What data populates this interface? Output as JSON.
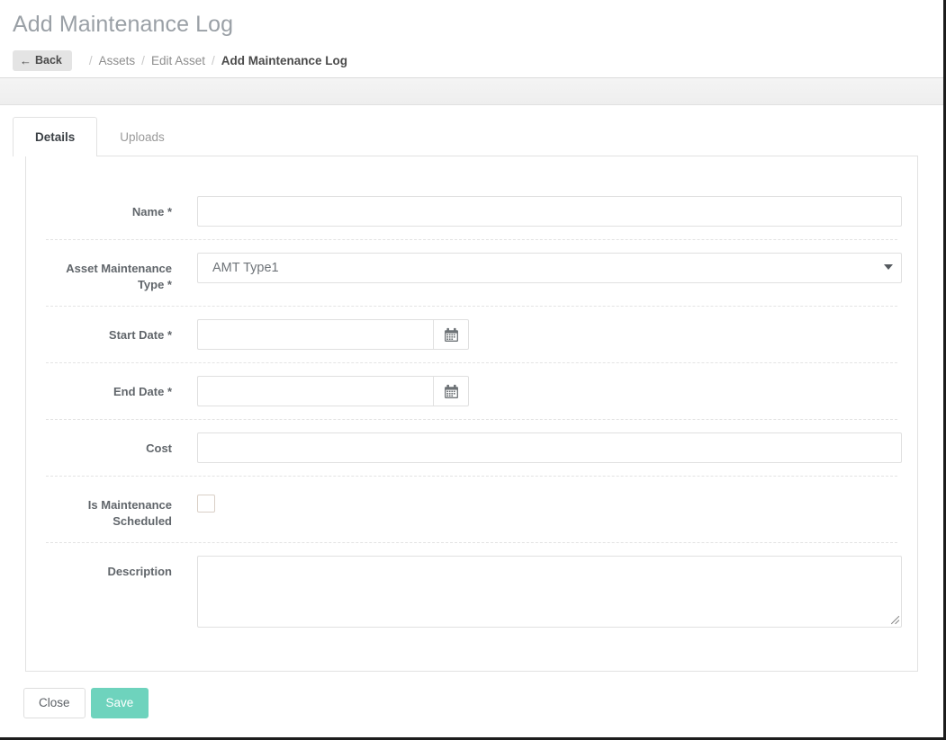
{
  "header": {
    "title": "Add Maintenance Log",
    "back_label": "Back",
    "back_icon": "arrow-left-icon",
    "breadcrumb": {
      "separator": "/",
      "items": [
        {
          "label": "Assets",
          "current": false
        },
        {
          "label": "Edit Asset",
          "current": false
        },
        {
          "label": "Add Maintenance Log",
          "current": true
        }
      ]
    }
  },
  "tabs": [
    {
      "label": "Details",
      "active": true
    },
    {
      "label": "Uploads",
      "active": false
    }
  ],
  "form": {
    "name": {
      "label": "Name *",
      "value": "",
      "placeholder": ""
    },
    "asset_maintenance_type": {
      "label": "Asset Maintenance Type *",
      "selected": "AMT Type1",
      "caret_icon": "chevron-down-icon"
    },
    "start_date": {
      "label": "Start Date *",
      "value": "",
      "placeholder": "",
      "picker_icon": "calendar-icon"
    },
    "end_date": {
      "label": "End Date *",
      "value": "",
      "placeholder": "",
      "picker_icon": "calendar-icon"
    },
    "cost": {
      "label": "Cost",
      "value": "",
      "placeholder": ""
    },
    "is_maintenance_scheduled": {
      "label": "Is Maintenance Scheduled",
      "checked": false
    },
    "description": {
      "label": "Description",
      "value": "",
      "placeholder": ""
    }
  },
  "footer": {
    "close_label": "Close",
    "save_label": "Save"
  },
  "colors": {
    "save_button": "#6ed3bd",
    "title_text": "#9aa0a6",
    "label_text": "#61666b",
    "toolbar_strip": "#f0f0f0",
    "border": "#e2e2e2"
  }
}
